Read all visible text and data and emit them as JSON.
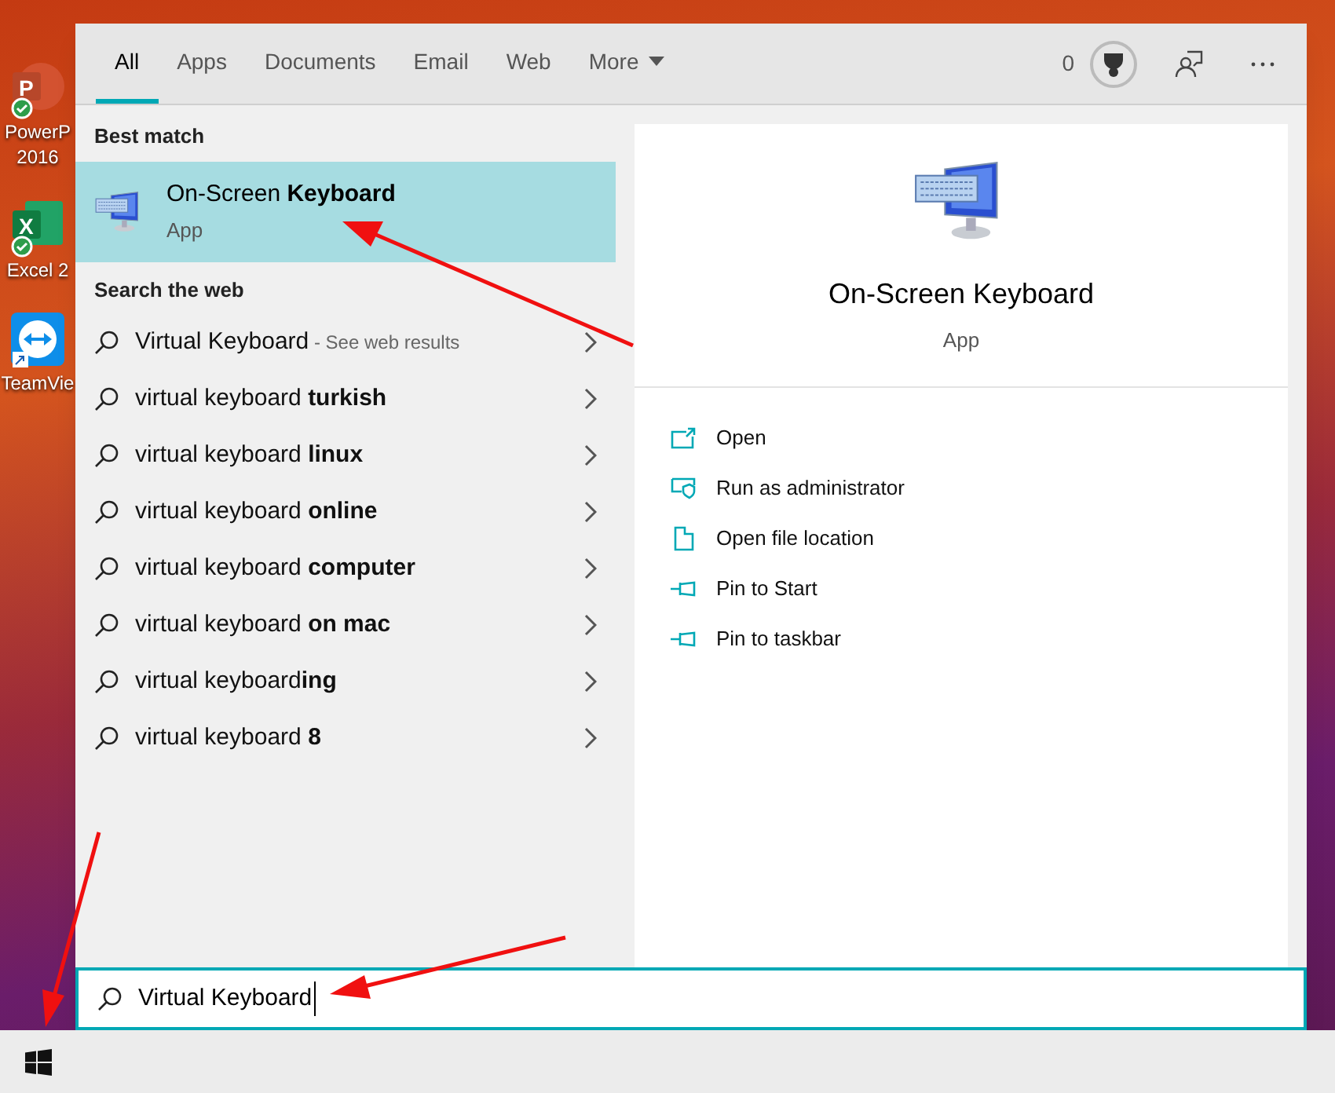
{
  "desktop_icons": [
    {
      "kind": "powerpoint",
      "glyph": "P",
      "label": [
        "PowerP",
        "2016"
      ]
    },
    {
      "kind": "excel",
      "glyph": "X",
      "label": [
        "Excel 2"
      ]
    },
    {
      "kind": "teamviewer",
      "label": [
        "TeamVie"
      ]
    }
  ],
  "tabs": [
    {
      "label": "All",
      "selected": true
    },
    {
      "label": "Apps",
      "selected": false
    },
    {
      "label": "Documents",
      "selected": false
    },
    {
      "label": "Email",
      "selected": false
    },
    {
      "label": "Web",
      "selected": false
    },
    {
      "label": "More",
      "selected": false,
      "dropdown": true
    }
  ],
  "rewards": {
    "count": "0"
  },
  "best_match": {
    "heading": "Best match",
    "title": "On-Screen **Keyboard**",
    "subtitle": "App",
    "selected": true
  },
  "web": {
    "heading": "Search the web",
    "results": [
      {
        "text": "Virtual Keyboard",
        "suffix": "- See web results"
      },
      {
        "text": "virtual keyboard **turkish**"
      },
      {
        "text": "virtual keyboard **linux**"
      },
      {
        "text": "virtual keyboard **online**"
      },
      {
        "text": "virtual keyboard **computer**"
      },
      {
        "text": "virtual keyboard **on mac**"
      },
      {
        "text": "virtual keyboard**ing**"
      },
      {
        "text": "virtual keyboard **8**"
      }
    ]
  },
  "preview": {
    "title": "On-Screen Keyboard",
    "subtitle": "App",
    "actions": [
      {
        "kind": "open",
        "label": "Open"
      },
      {
        "kind": "admin",
        "label": "Run as administrator"
      },
      {
        "kind": "folder",
        "label": "Open file location"
      },
      {
        "kind": "pin",
        "label": "Pin to Start"
      },
      {
        "kind": "pin",
        "label": "Pin to taskbar"
      }
    ]
  },
  "search_box": {
    "value": "Virtual Keyboard"
  }
}
